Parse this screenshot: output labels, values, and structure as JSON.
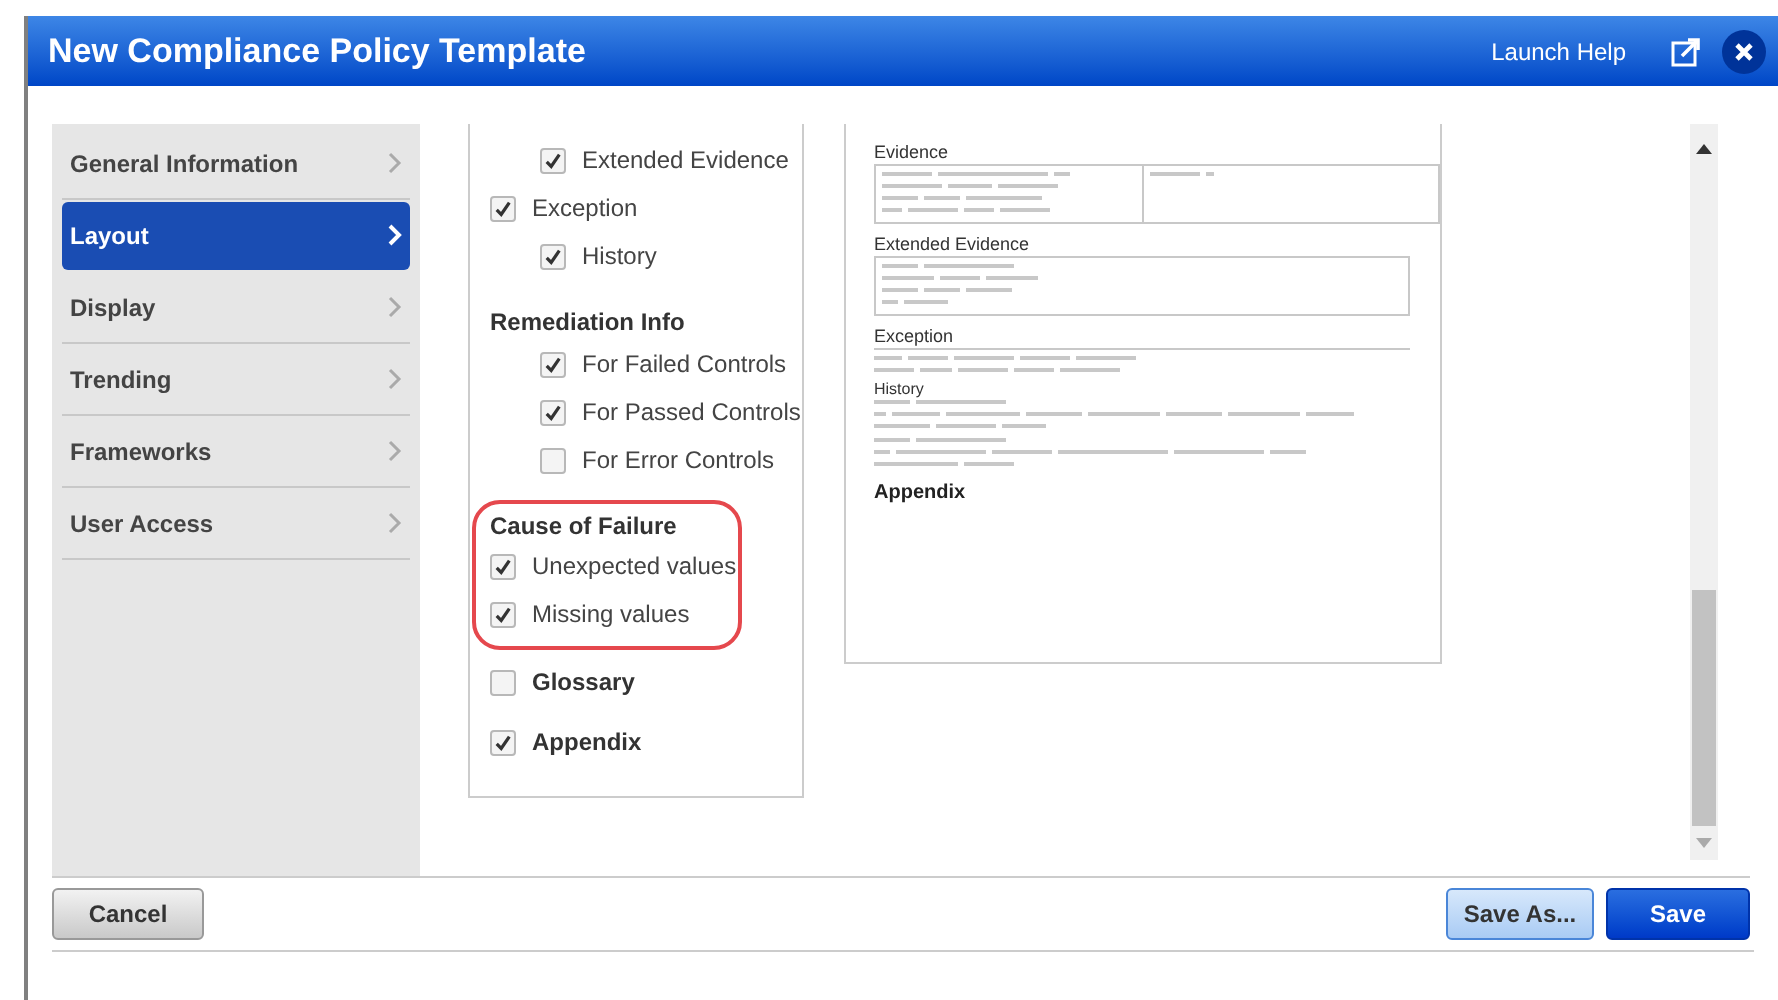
{
  "window": {
    "title": "New Compliance Policy Template",
    "help_link": "Launch Help"
  },
  "sidebar": {
    "items": [
      {
        "label": "General Information",
        "selected": false
      },
      {
        "label": "Layout",
        "selected": true
      },
      {
        "label": "Display",
        "selected": false
      },
      {
        "label": "Trending",
        "selected": false
      },
      {
        "label": "Frameworks",
        "selected": false
      },
      {
        "label": "User Access",
        "selected": false
      }
    ]
  },
  "options": [
    {
      "kind": "continuation",
      "children": [
        {
          "label": "Extended Evidence",
          "checked": true
        }
      ]
    },
    {
      "kind": "checkbox",
      "label": "Exception",
      "checked": true,
      "children": [
        {
          "label": "History",
          "checked": true
        }
      ]
    },
    {
      "kind": "heading",
      "label": "Remediation Info",
      "children": [
        {
          "label": "For Failed Controls",
          "checked": true
        },
        {
          "label": "For Passed Controls",
          "checked": true
        },
        {
          "label": "For Error Controls",
          "checked": false
        }
      ]
    },
    {
      "kind": "callout",
      "label": "Cause of Failure",
      "items": [
        {
          "label": "Unexpected values",
          "checked": true
        },
        {
          "label": "Missing values",
          "checked": true
        }
      ]
    },
    {
      "kind": "checkbox",
      "label": "Glossary",
      "checked": false,
      "bold": true
    },
    {
      "kind": "checkbox",
      "label": "Appendix",
      "checked": true,
      "bold": true
    }
  ],
  "preview": {
    "sections": [
      {
        "kind": "boxed-split",
        "title": "Evidence"
      },
      {
        "kind": "boxed",
        "title": "Extended Evidence"
      },
      {
        "kind": "ruled",
        "title": "Exception"
      },
      {
        "kind": "history",
        "title": "History"
      },
      {
        "kind": "bold",
        "title": "Appendix"
      }
    ]
  },
  "footer": {
    "cancel": "Cancel",
    "save_as": "Save As...",
    "save": "Save"
  }
}
